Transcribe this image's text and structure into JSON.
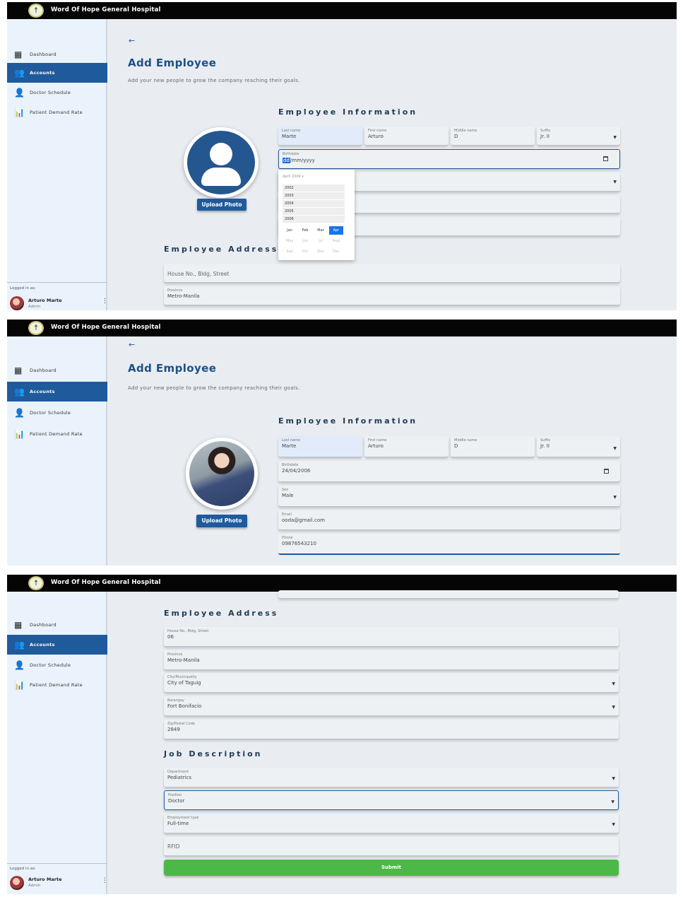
{
  "app": {
    "brand": "Word Of Hope General Hospital",
    "logo_glyph": "☨"
  },
  "sidebar": {
    "items": [
      {
        "label": "Dashboard",
        "icon": "dashboard-icon"
      },
      {
        "label": "Accounts",
        "icon": "accounts-icon"
      },
      {
        "label": "Doctor Schedule",
        "icon": "doctor-schedule-icon"
      },
      {
        "label": "Patient Demand Rate",
        "icon": "demand-rate-icon"
      }
    ],
    "active": "Accounts",
    "logged_in_label": "Logged in as:",
    "user_name": "Arturo Marte",
    "user_role": "Admin"
  },
  "page": {
    "back_glyph": "←",
    "title": "Add Employee",
    "subtitle": "Add your new people to grow the company reaching their goals.",
    "upload_photo": "Upload Photo"
  },
  "employee_information": {
    "heading": "Employee Information",
    "labels": {
      "last_name": "Last name",
      "first_name": "First name",
      "middle_name": "Middle name",
      "suffix": "Suffix",
      "birthdate": "Birthdate",
      "sex": "Sex",
      "email": "Email",
      "phone": "Phone"
    },
    "first_view": {
      "last_name": "Marte",
      "first_name": "Arturo",
      "middle_name": "D",
      "suffix": "Jr. II",
      "birthdate_segment": "dd",
      "birthdate_rest": "/mm/yyyy"
    },
    "second_view": {
      "last_name": "Marte",
      "first_name": "Arturo",
      "middle_name": "D",
      "suffix": "Jr. II",
      "birthdate": "24/04/2006",
      "sex": "Male",
      "email": "ooda@gmail.com",
      "phone": "09876543210"
    }
  },
  "date_picker": {
    "header": "April 2006 ▾",
    "years": [
      "2002",
      "2003",
      "2004",
      "2005",
      "2006"
    ],
    "months": [
      "Jan",
      "Feb",
      "Mar",
      "Apr",
      "May",
      "Jun",
      "Jul",
      "Aug",
      "Sep",
      "Oct",
      "Nov",
      "Dec"
    ],
    "selected_month": "Apr"
  },
  "employee_address": {
    "heading": "Employee Address",
    "house_placeholder": "House No., Bldg, Street",
    "labels": {
      "house": "House No., Bldg, Street",
      "province": "Province",
      "city": "City/Municipality",
      "barangay": "Barangay",
      "zip": "Zip/Postal Code"
    },
    "values": {
      "house": "06",
      "province": "Metro-Manila",
      "city": "City of Taguig",
      "barangay": "Fort Bonifacio",
      "zip": "2849"
    }
  },
  "job_description": {
    "heading": "Job Description",
    "labels": {
      "department": "Department",
      "position": "Position",
      "employment_type": "Employment type"
    },
    "values": {
      "department": "Pediatrics",
      "position": "Doctor",
      "employment_type": "Full-time"
    },
    "rfid_placeholder": "RFID",
    "submit": "Submit"
  },
  "colors": {
    "topbar": "#050505",
    "sidebar_bg": "#eaf3fc",
    "accent_blue": "#1f5a9c",
    "submit_green": "#4cb848",
    "content_bg": "#e9edf1"
  }
}
